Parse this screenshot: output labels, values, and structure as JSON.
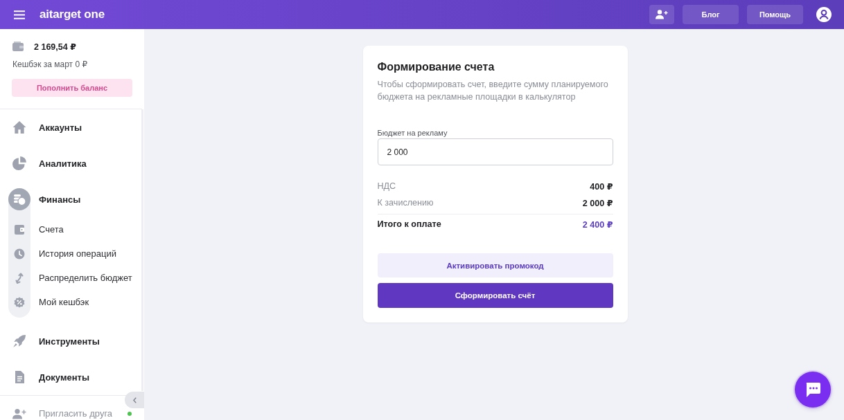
{
  "header": {
    "logo": "aitarget one",
    "links": [
      {
        "label": "Блог"
      },
      {
        "label": "Помощь"
      }
    ]
  },
  "sidebar": {
    "balance": "2 169,54 ₽",
    "cashback": "Кешбэк за март 0 ₽",
    "top_up_button": "Пополнить баланс",
    "items": [
      {
        "label": "Аккаунты",
        "selected": false
      },
      {
        "label": "Аналитика",
        "selected": false
      },
      {
        "label": "Финансы",
        "selected": true,
        "children": [
          {
            "label": "Счета"
          },
          {
            "label": "История операций"
          },
          {
            "label": "Распределить бюджет"
          },
          {
            "label": "Мой кешбэк"
          }
        ]
      },
      {
        "label": "Инструменты",
        "selected": false
      },
      {
        "label": "Документы",
        "selected": false
      }
    ],
    "invite_item": {
      "label": "Пригласить друга",
      "new": true
    }
  },
  "invoice_card": {
    "title": "Формирование счета",
    "description": "Чтобы сформировать счет, введите сумму планируемого бюджета на рекламные площадки в калькулятор",
    "budget_field": {
      "label": "Бюджет на рекламу",
      "value": "2 000"
    },
    "summary": [
      {
        "kind": "line",
        "label": "НДС",
        "value": "400 ₽"
      },
      {
        "kind": "line",
        "label": "К зачислению",
        "value": "2 000 ₽"
      },
      {
        "kind": "total",
        "label": "Итого к оплате",
        "value": "2 400 ₽"
      }
    ],
    "promo_button": "Активировать промокод",
    "submit_button": "Сформировать счёт"
  }
}
